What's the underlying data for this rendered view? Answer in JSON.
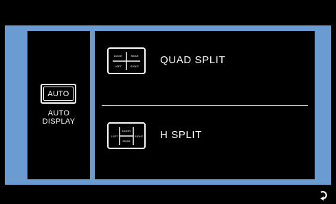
{
  "auto": {
    "button_label": "AUTO",
    "caption_line1": "AUTO",
    "caption_line2": "DISPLAY"
  },
  "options": [
    {
      "label": "QUAD SPLIT",
      "icon": "quad-split-icon",
      "icon_labels": {
        "top_left": "DOOR",
        "top_right": "REAR",
        "bottom_left": "LEFT",
        "bottom_right": "RIGHT"
      }
    },
    {
      "label": "H SPLIT",
      "icon": "h-split-icon",
      "icon_labels": {
        "left": "LEFT",
        "center_top": "DOOR",
        "center_bottom": "REAR",
        "right": "RIGHT"
      }
    }
  ],
  "back": {
    "icon": "back-arrow-icon"
  },
  "colors": {
    "frame": "#6a9bd1",
    "background": "#000000",
    "foreground": "#ffffff"
  }
}
